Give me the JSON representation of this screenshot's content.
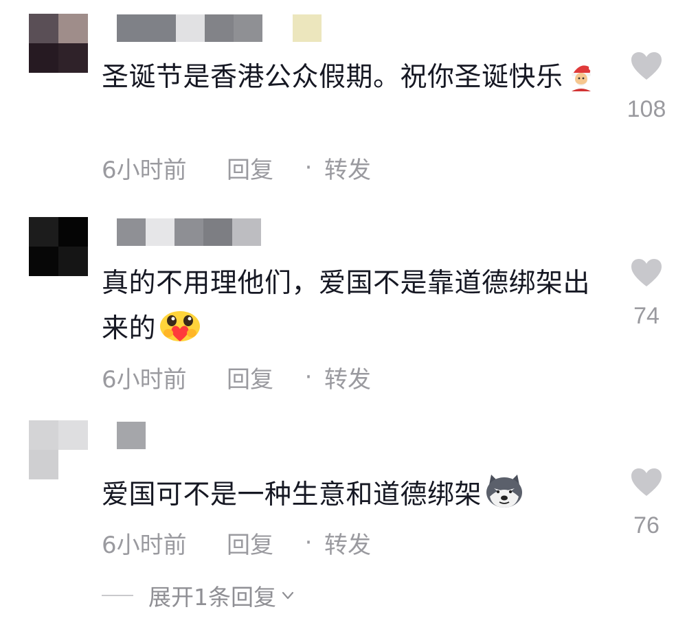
{
  "comments": [
    {
      "text": "圣诞节是香港公众假期。祝你圣诞快乐",
      "emoji": "santa-emoji",
      "time": "6小时前",
      "reply": "回复",
      "separator": "·",
      "share": "转发",
      "likes": "108"
    },
    {
      "text": "真的不用理他们，爱国不是靠道德绑架出来的",
      "emoji": "hug-heart-emoji",
      "time": "6小时前",
      "reply": "回复",
      "separator": "·",
      "share": "转发",
      "likes": "74"
    },
    {
      "text": "爱国可不是一种生意和道德绑架",
      "emoji": "husky-dog-emoji",
      "time": "6小时前",
      "reply": "回复",
      "separator": "·",
      "share": "转发",
      "likes": "76"
    }
  ],
  "expand_replies": "展开1条回复",
  "colors": {
    "text": "#161823",
    "meta": "#9a9a9f",
    "heart": "#c8c8cc"
  }
}
